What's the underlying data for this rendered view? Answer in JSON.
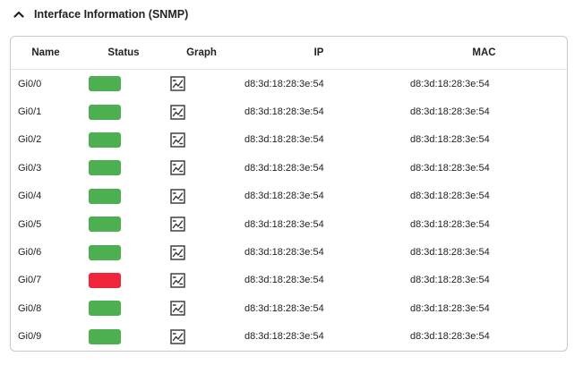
{
  "section": {
    "title": "Interface Information (SNMP)",
    "expanded": true,
    "collapse_icon": "chevron-up-icon"
  },
  "table": {
    "columns": [
      "Name",
      "Status",
      "Graph",
      "IP",
      "MAC"
    ],
    "graph_icon": "graph-icon",
    "status_colors": {
      "up": "#4caf50",
      "down": "#f0253a"
    },
    "rows": [
      {
        "name": "Gi0/0",
        "status": "up",
        "ip": "d8:3d:18:28:3e:54",
        "mac": "d8:3d:18:28:3e:54"
      },
      {
        "name": "Gi0/1",
        "status": "up",
        "ip": "d8:3d:18:28:3e:54",
        "mac": "d8:3d:18:28:3e:54"
      },
      {
        "name": "Gi0/2",
        "status": "up",
        "ip": "d8:3d:18:28:3e:54",
        "mac": "d8:3d:18:28:3e:54"
      },
      {
        "name": "Gi0/3",
        "status": "up",
        "ip": "d8:3d:18:28:3e:54",
        "mac": "d8:3d:18:28:3e:54"
      },
      {
        "name": "Gi0/4",
        "status": "up",
        "ip": "d8:3d:18:28:3e:54",
        "mac": "d8:3d:18:28:3e:54"
      },
      {
        "name": "Gi0/5",
        "status": "up",
        "ip": "d8:3d:18:28:3e:54",
        "mac": "d8:3d:18:28:3e:54"
      },
      {
        "name": "Gi0/6",
        "status": "up",
        "ip": "d8:3d:18:28:3e:54",
        "mac": "d8:3d:18:28:3e:54"
      },
      {
        "name": "Gi0/7",
        "status": "down",
        "ip": "d8:3d:18:28:3e:54",
        "mac": "d8:3d:18:28:3e:54"
      },
      {
        "name": "Gi0/8",
        "status": "up",
        "ip": "d8:3d:18:28:3e:54",
        "mac": "d8:3d:18:28:3e:54"
      },
      {
        "name": "Gi0/9",
        "status": "up",
        "ip": "d8:3d:18:28:3e:54",
        "mac": "d8:3d:18:28:3e:54"
      }
    ]
  }
}
